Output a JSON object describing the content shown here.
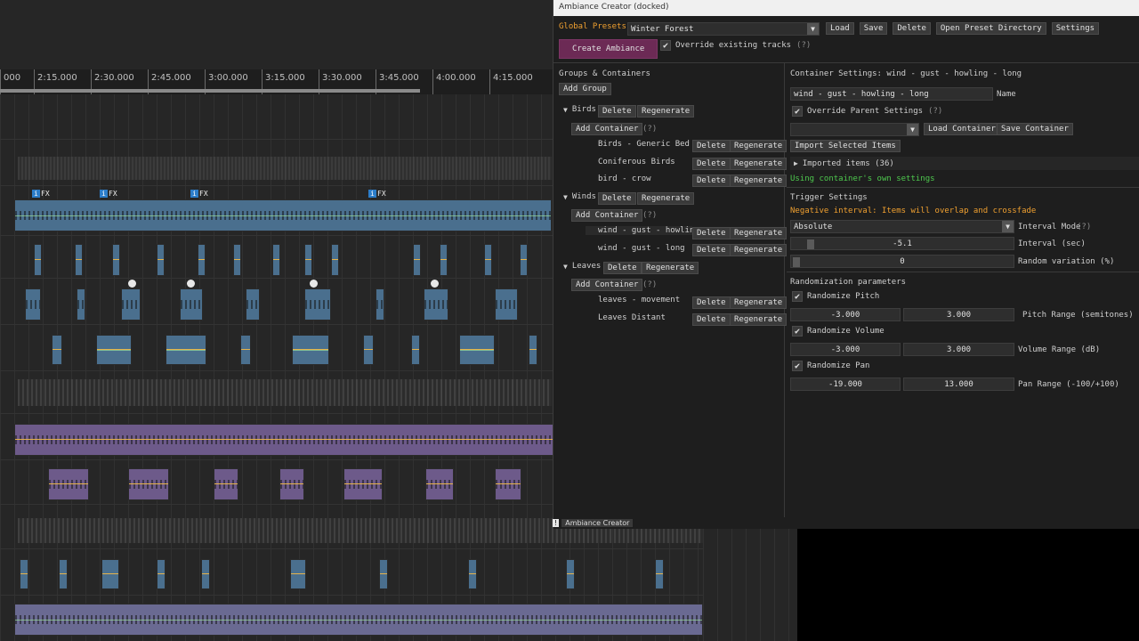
{
  "timeline": {
    "ruler": [
      "000",
      "2:15.000",
      "2:30.000",
      "2:45.000",
      "3:00.000",
      "3:15.000",
      "3:30.000",
      "3:45.000",
      "4:00.000",
      "4:15.000"
    ],
    "item_badges": {
      "info": "i",
      "fx": "FX"
    }
  },
  "panel": {
    "window_title": "Ambiance Creator (docked)",
    "dock_tab": {
      "mark": "!",
      "label": "Ambiance Creator"
    },
    "global_presets": {
      "label": "Global Presets",
      "selected": "Winter Forest",
      "load": "Load",
      "save": "Save",
      "delete": "Delete",
      "open_dir": "Open Preset Directory",
      "settings": "Settings"
    },
    "create_button": "Create Ambiance",
    "override_tracks": {
      "label": "Override existing tracks",
      "help": "(?)",
      "checked": true
    },
    "groups": {
      "title": "Groups & Containers",
      "add_group": "Add Group",
      "delete": "Delete",
      "regenerate": "Regenerate",
      "add_container": "Add Container",
      "help": "(?)",
      "list": [
        {
          "name": "Birds",
          "containers": [
            "Birds - Generic Bed C",
            "Coniferous Birds",
            "bird - crow"
          ]
        },
        {
          "name": "Winds",
          "containers": [
            "wind - gust - howling",
            "wind - gust - long"
          ]
        },
        {
          "name": "Leaves",
          "containers": [
            "leaves - movement",
            "Leaves Distant"
          ]
        }
      ]
    },
    "container": {
      "title": "Container Settings: wind - gust - howling - long",
      "name_value": "wind - gust - howling - long",
      "name_label": "Name",
      "override_parent": {
        "label": "Override Parent Settings",
        "help": "(?)",
        "checked": true
      },
      "preset_select": "",
      "load_container": "Load Container",
      "save_container": "Save Container",
      "import_selected": "Import Selected Items",
      "imported_items": "Imported items (36)",
      "own_settings": "Using container's own settings"
    },
    "trigger": {
      "title": "Trigger Settings",
      "warning": "Negative interval: Items will overlap and crossfade",
      "interval_mode": {
        "value": "Absolute",
        "label": "Interval Mode",
        "help": "(?)"
      },
      "interval": {
        "value": "-5.1",
        "label": "Interval (sec)"
      },
      "random_variation": {
        "value": "0",
        "label": "Random variation (%)"
      }
    },
    "randomization": {
      "title": "Randomization parameters",
      "pitch": {
        "label": "Randomize Pitch",
        "checked": true,
        "min": "-3.000",
        "max": "3.000",
        "range_label": "Pitch Range (semitones)"
      },
      "volume": {
        "label": "Randomize Volume",
        "checked": true,
        "min": "-3.000",
        "max": "3.000",
        "range_label": "Volume Range (dB)"
      },
      "pan": {
        "label": "Randomize Pan",
        "checked": true,
        "min": "-19.000",
        "max": "13.000",
        "range_label": "Pan Range (-100/+100)"
      }
    },
    "colors": {
      "create_button": "#6c2a55",
      "warning": "#f0a030",
      "info": "#4ec94e"
    }
  }
}
